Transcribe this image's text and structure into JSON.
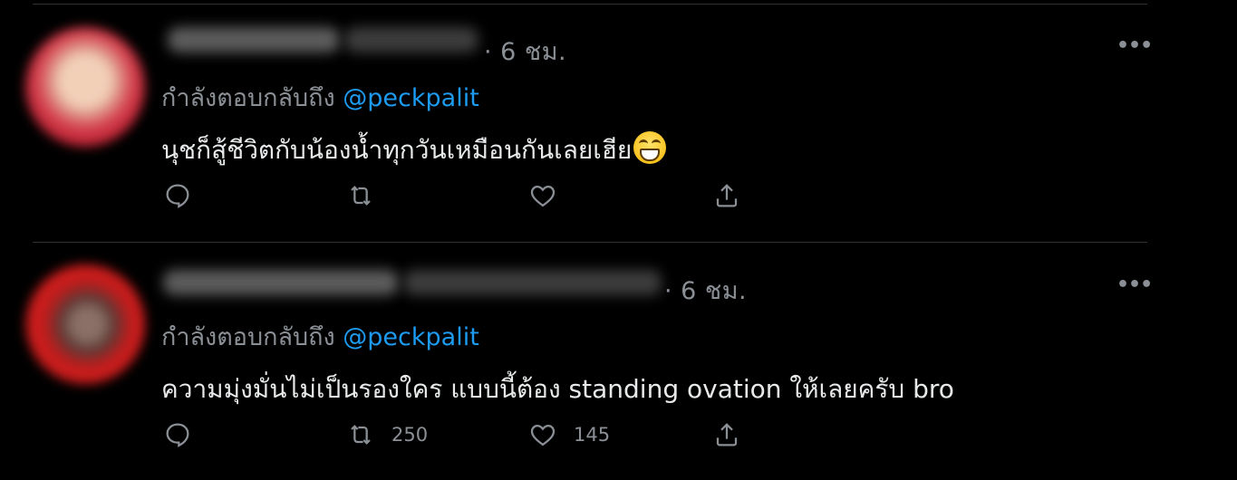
{
  "tweets": [
    {
      "time": "· 6 ชม.",
      "more_label": "•••",
      "replying_prefix": "กำลังตอบกลับถึง",
      "mention": "@peckpalit",
      "text": "นุชก็สู้ชีวิตกับน้องน้ำทุกวันเหมือนกันเลยเฮีย",
      "emoji": "grinning-face",
      "retweets": "",
      "likes": ""
    },
    {
      "time": "· 6 ชม.",
      "more_label": "•••",
      "replying_prefix": "กำลังตอบกลับถึง",
      "mention": "@peckpalit",
      "text": "ความมุ่งมั่นไม่เป็นรองใคร แบบนี้ต้อง standing ovation ให้เลยครับ bro",
      "retweets": "250",
      "likes": "145"
    }
  ],
  "colors": {
    "background": "#000000",
    "text": "#e7e9ea",
    "muted": "#8b9096",
    "accent": "#1d9bf0",
    "divider": "#2f3336"
  }
}
